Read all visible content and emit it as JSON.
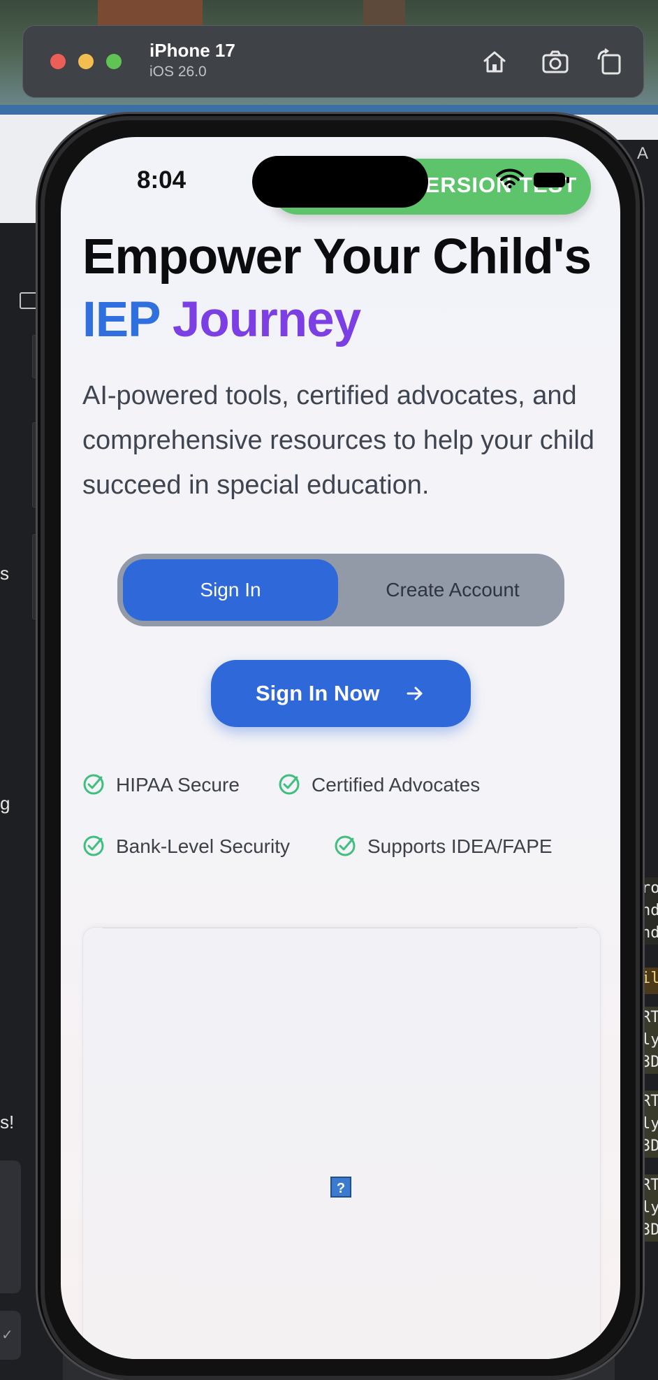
{
  "simulator": {
    "device_name": "iPhone 17",
    "os_version": "iOS 26.0",
    "traffic_lights": [
      "#ec5f57",
      "#f4bd4f",
      "#5fc454"
    ],
    "buttons": [
      "home-icon",
      "screenshot-icon",
      "rotate-icon"
    ]
  },
  "background": {
    "left_panel_texts": [
      "s",
      "g",
      "s!",
      "✓"
    ],
    "right_panel_code": [
      "ro",
      "nd",
      "nd",
      "il",
      "RT",
      "ly",
      "3D",
      "RT",
      "ly",
      "3D",
      "RT",
      "ly",
      "3D"
    ],
    "right_top_text": "A"
  },
  "status_bar": {
    "time": "8:04"
  },
  "banner": {
    "label": "VERSION TEST",
    "color": "#5ec46c"
  },
  "hero": {
    "title_line1": "Empower Your Child's",
    "title_word_blue": "IEP",
    "title_word_purple": "Journey",
    "subtitle": "AI-powered tools, certified advocates, and comprehensive resources to help your child succeed in special education."
  },
  "auth_toggle": {
    "selected": "Sign In",
    "options": [
      "Sign In",
      "Create Account"
    ]
  },
  "cta": {
    "label": "Sign In Now",
    "icon": "arrow-right-icon"
  },
  "badges": [
    "HIPAA Secure",
    "Certified Advocates",
    "Bank-Level Security",
    "Supports IDEA/FAPE"
  ],
  "colors": {
    "primary": "#2f69d9",
    "accent_purple": "#7b3fe4",
    "check_green": "#3fbf7f"
  },
  "card": {
    "placeholder_icon": "?"
  }
}
